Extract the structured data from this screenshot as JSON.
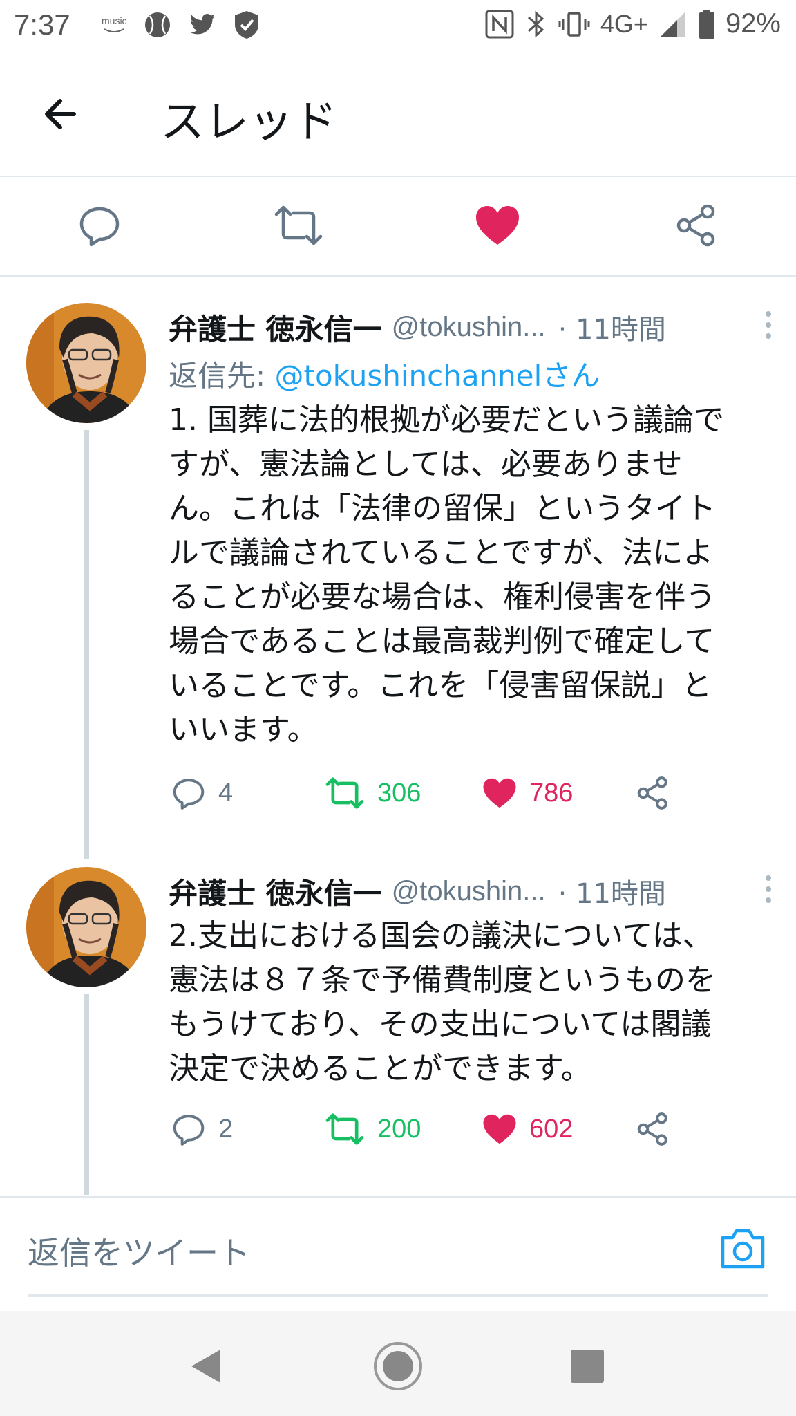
{
  "status_bar": {
    "time": "7:37",
    "music_label": "music",
    "network": "4G+",
    "battery": "92%"
  },
  "header": {
    "title": "スレッド"
  },
  "colors": {
    "like": "#e0245e",
    "retweet": "#17bf63",
    "link": "#1da1f2",
    "muted": "#657786"
  },
  "tweets": [
    {
      "name": "弁護士 徳永信一",
      "handle": "@tokushin...",
      "time": "· 11時間",
      "reply_prefix": "返信先: ",
      "reply_mention": "@tokushinchannelさん",
      "lines": [
        "1. 国葬に法的根拠が必要だという議論で",
        "すが、憲法論としては、必要ありませ",
        "ん。これは「法律の留保」というタイト",
        "ルで議論されていることですが、法によ",
        "ることが必要な場合は、権利侵害を伴う",
        "場合であることは最高裁判例で確定して",
        "いることです。これを「侵害留保説」と",
        "いいます。"
      ],
      "replies": "4",
      "retweets": "306",
      "likes": "786"
    },
    {
      "name": "弁護士 徳永信一",
      "handle": "@tokushin...",
      "time": "· 11時間",
      "lines": [
        "2.支出における国会の議決については、",
        "憲法は８７条で予備費制度というものを",
        "もうけており、その支出については閣議",
        "決定で決めることができます。"
      ],
      "replies": "2",
      "retweets": "200",
      "likes": "602"
    }
  ],
  "compose": {
    "placeholder": "返信をツイート"
  }
}
